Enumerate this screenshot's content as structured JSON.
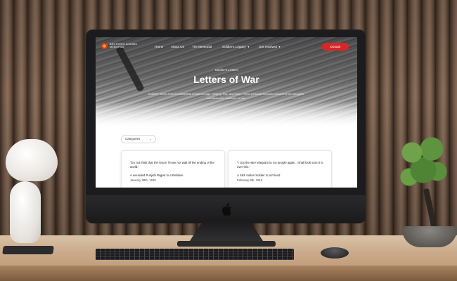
{
  "site": {
    "logo_line1": "BROTHERS IN ARMS",
    "logo_line2": "MEMORIAL",
    "nav": {
      "items": [
        "Home",
        "About Us",
        "The Memorial",
        "Soldier's Legacy",
        "Get Involved"
      ],
      "caret_items": [
        false,
        false,
        false,
        true,
        true
      ],
      "donate_label": "Donate"
    },
    "hero": {
      "subtitle": "Soldier's Letters",
      "title": "Letters of War",
      "description": "Soldiers' letters from the battlefield reveal courage, longing, fear, and hope. These personal accounts document the struggles, sacrifices and resilience of war."
    },
    "filter": {
      "label": "Categories",
      "caret": "⌄"
    },
    "cards": [
      {
        "quote": "“Do not think that the return Those not wait till the ending of the world.”",
        "author": "A wounded Punjabi Rajput to a Relative",
        "date": "January 28th, 1915"
      },
      {
        "quote": "“I Got the wire telegram to my people again. I shall look sure it is over this.”",
        "author": "A Sikh Indian Soldier to a Friend",
        "date": "February 9th, 1915"
      }
    ]
  },
  "colors": {
    "donate": "#d72626",
    "logo_orange": "#f6a020",
    "logo_red": "#d2401a"
  },
  "icons": {
    "logo": "sunburst-emblem-icon",
    "apple": "apple-logo-icon",
    "dropdown": "chevron-down-icon"
  }
}
